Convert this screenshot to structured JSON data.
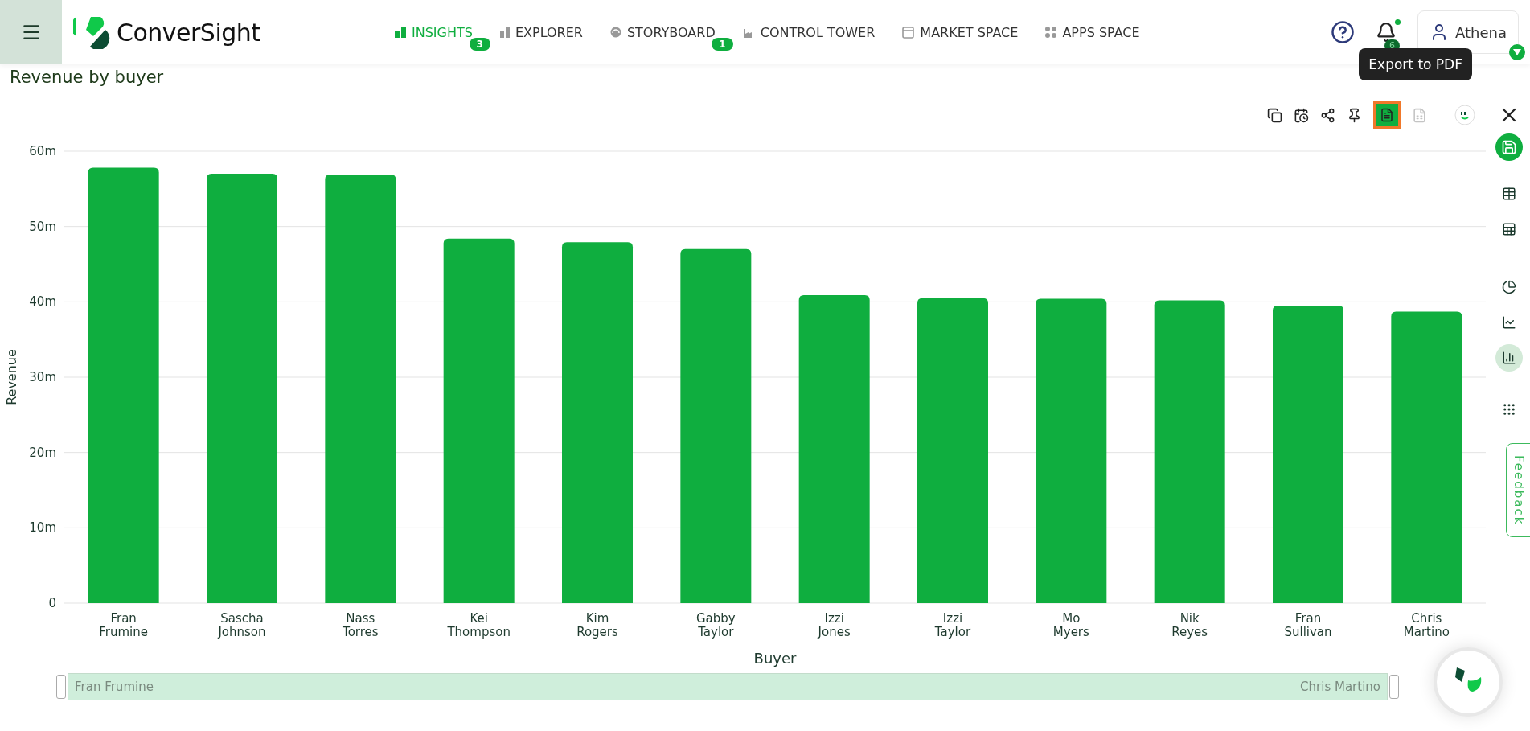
{
  "header": {
    "brand": "ConverSight",
    "nav": [
      {
        "label": "INSIGHTS",
        "selected": true,
        "badge": "3"
      },
      {
        "label": "EXPLORER",
        "selected": false
      },
      {
        "label": "STORYBOARD",
        "selected": false,
        "badge": "1"
      },
      {
        "label": "CONTROL TOWER",
        "selected": false
      },
      {
        "label": "MARKET SPACE",
        "selected": false
      },
      {
        "label": "APPS SPACE",
        "selected": false
      }
    ],
    "notifications": "6",
    "user": "Athena"
  },
  "title": "Revenue by buyer",
  "toolbar": {
    "tooltip": "Export to PDF",
    "buttons": [
      {
        "highlighted": false,
        "disabled": false
      },
      {
        "highlighted": false,
        "disabled": false
      },
      {
        "highlighted": false,
        "disabled": false
      },
      {
        "highlighted": false,
        "disabled": false
      },
      {
        "highlighted": true,
        "disabled": false
      },
      {
        "highlighted": false,
        "disabled": true
      }
    ]
  },
  "sidebar": {
    "items": [
      {
        "kind": "action"
      },
      {
        "kind": "view",
        "selected": false
      },
      {
        "kind": "view",
        "selected": false
      },
      {
        "kind": "view",
        "selected": false
      },
      {
        "kind": "view",
        "selected": false
      },
      {
        "kind": "view",
        "selected": true
      },
      {
        "kind": "action"
      }
    ]
  },
  "feedback": "Feedback",
  "chart_data": {
    "type": "bar",
    "xlabel": "Buyer",
    "ylabel": "Revenue",
    "categories": [
      "Fran Frumine",
      "Sascha Johnson",
      "Nass Torres",
      "Kei Thompson",
      "Kim Rogers",
      "Gabby Taylor",
      "Izzi Jones",
      "Izzi Taylor",
      "Mo Myers",
      "Nik Reyes",
      "Fran Sullivan",
      "Chris Martino"
    ],
    "grid": true,
    "series": [
      {
        "color": "#0fae3f",
        "values": [
          57.8,
          57.0,
          56.9,
          48.4,
          47.9,
          47.0,
          40.9,
          40.5,
          40.4,
          40.2,
          39.5,
          38.7
        ]
      }
    ],
    "ylim": [
      0,
      60
    ],
    "yticks": [
      {
        "value": 0,
        "label": "0"
      },
      {
        "value": 10,
        "label": "10m"
      },
      {
        "value": 20,
        "label": "20m"
      },
      {
        "value": 30,
        "label": "30m"
      },
      {
        "value": 40,
        "label": "40m"
      },
      {
        "value": 50,
        "label": "50m"
      },
      {
        "value": 60,
        "label": "60m"
      }
    ]
  },
  "range_slider": {
    "start_label": "Fran Frumine",
    "end_label": "Chris Martino",
    "level": 1
  }
}
